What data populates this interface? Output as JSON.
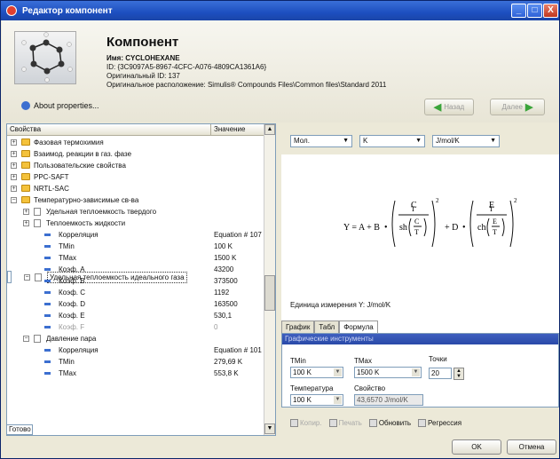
{
  "window": {
    "title": "Редактор компонент",
    "min_label": "_",
    "max_label": "□",
    "close_label": "X"
  },
  "header": {
    "component_title": "Компонент",
    "name_line": "Имя: CYCLOHEXANE",
    "id_line": "ID: {3C9097A5-8967-4CFC-A076-4809CA1361A6}",
    "orig_id_line": "Оригинальный ID: 137",
    "orig_location_line": "Оригинальное расположение: Simulis® Compounds Files\\Common files\\Standard 2011",
    "about_label": "About properties...",
    "back_label": "Назад",
    "next_label": "Далее"
  },
  "left_pane": {
    "col_property": "Свойства",
    "col_value": "Значение",
    "tree": [
      {
        "label": "Фазовая термохимия",
        "value": "",
        "level": 0,
        "icon": "folder",
        "exp": "+",
        "state": ""
      },
      {
        "label": "Взаимод. реакции в газ. фазе",
        "value": "",
        "level": 0,
        "icon": "folder",
        "exp": "+",
        "state": ""
      },
      {
        "label": "Пользовательские свойства",
        "value": "",
        "level": 0,
        "icon": "folder",
        "exp": "+",
        "state": ""
      },
      {
        "label": "PPC-SAFT",
        "value": "",
        "level": 0,
        "icon": "folder",
        "exp": "+",
        "state": ""
      },
      {
        "label": "NRTL-SAC",
        "value": "",
        "level": 0,
        "icon": "folder",
        "exp": "+",
        "state": ""
      },
      {
        "label": "Температурно-зависимые св-ва",
        "value": "",
        "level": 0,
        "icon": "folder",
        "exp": "−",
        "state": ""
      },
      {
        "label": "Удельная теплоемкость твердого",
        "value": "",
        "level": 1,
        "icon": "page",
        "exp": "+",
        "state": ""
      },
      {
        "label": "Теплоемкость жидкости",
        "value": "",
        "level": 1,
        "icon": "page",
        "exp": "+",
        "state": ""
      },
      {
        "label": "Удельная теплоемкость идеального газа",
        "value": "",
        "level": 1,
        "icon": "page",
        "exp": "−",
        "state": "selected"
      },
      {
        "label": "Корреляция",
        "value": "Equation # 107",
        "level": 2,
        "icon": "bullet",
        "exp": "",
        "state": ""
      },
      {
        "label": "TMin",
        "value": "100 K",
        "level": 2,
        "icon": "bullet",
        "exp": "",
        "state": ""
      },
      {
        "label": "TMax",
        "value": "1500 K",
        "level": 2,
        "icon": "bullet",
        "exp": "",
        "state": ""
      },
      {
        "label": "Коэф. A",
        "value": "43200",
        "level": 2,
        "icon": "bullet",
        "exp": "",
        "state": ""
      },
      {
        "label": "Коэф. B",
        "value": "373500",
        "level": 2,
        "icon": "bullet",
        "exp": "",
        "state": ""
      },
      {
        "label": "Коэф. C",
        "value": "1192",
        "level": 2,
        "icon": "bullet",
        "exp": "",
        "state": ""
      },
      {
        "label": "Коэф. D",
        "value": "163500",
        "level": 2,
        "icon": "bullet",
        "exp": "",
        "state": ""
      },
      {
        "label": "Коэф. E",
        "value": "530,1",
        "level": 2,
        "icon": "bullet",
        "exp": "",
        "state": ""
      },
      {
        "label": "Коэф. F",
        "value": "0",
        "level": 2,
        "icon": "bullet",
        "exp": "",
        "state": "dim"
      },
      {
        "label": "Давление пара",
        "value": "",
        "level": 1,
        "icon": "page",
        "exp": "−",
        "state": ""
      },
      {
        "label": "Корреляция",
        "value": "Equation # 101",
        "level": 2,
        "icon": "bullet",
        "exp": "",
        "state": ""
      },
      {
        "label": "TMin",
        "value": "279,69 K",
        "level": 2,
        "icon": "bullet",
        "exp": "",
        "state": ""
      },
      {
        "label": "TMax",
        "value": "553,8 K",
        "level": 2,
        "icon": "bullet",
        "exp": "",
        "state": ""
      }
    ],
    "status": "Готово"
  },
  "right_pane": {
    "unit_sel_1": "Мол.",
    "unit_sel_2": "K",
    "unit_sel_3": "J/mol/K",
    "formula": {
      "lhs": "Y = A + B",
      "mid": "+ D",
      "c": "C",
      "t": "T",
      "e": "E",
      "sh": "sh",
      "ch": "ch",
      "exp": "2"
    },
    "unit_line": "Единица измерения Y: J/mol/K",
    "tabs": [
      "График",
      "Табл",
      "Формула"
    ],
    "tools_title": "Графические инструменты",
    "tmin_label": "TMin",
    "tmax_label": "TMax",
    "points_label": "Точки",
    "tmin_value": "100 K",
    "tmax_value": "1500 K",
    "points_value": "20",
    "temp_label": "Температура",
    "prop_label": "Свойство",
    "temp_value": "100 K",
    "prop_value": "43,6570 J/mol/K",
    "tb_copy": "Копир.",
    "tb_print": "Печать",
    "tb_refresh": "Обновить",
    "tb_regress": "Регрессия"
  },
  "buttons": {
    "ok": "OK",
    "cancel": "Отмена"
  }
}
